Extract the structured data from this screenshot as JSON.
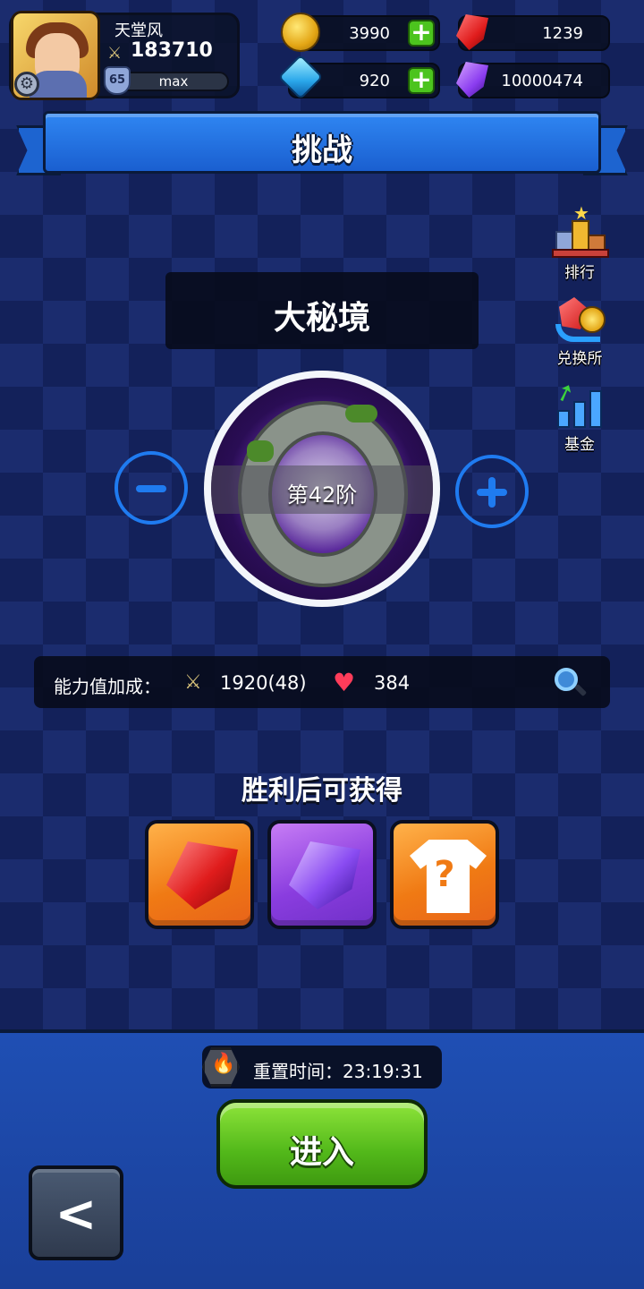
{
  "player": {
    "name": "天堂风",
    "power": "183710",
    "level": "65",
    "level_status": "max"
  },
  "resources": {
    "gold": "3990",
    "diamond": "920",
    "red_gem": "1239",
    "purple_gem": "10000474"
  },
  "header": {
    "title": "挑战"
  },
  "side_menu": {
    "items": [
      {
        "label": "排行",
        "icon": "ranking-podium-icon"
      },
      {
        "label": "兑换所",
        "icon": "exchange-icon"
      },
      {
        "label": "基金",
        "icon": "fund-chart-icon"
      }
    ]
  },
  "dungeon": {
    "name": "大秘境",
    "tier": "第42阶"
  },
  "stats": {
    "label": "能力值加成：",
    "attack": "1920(48)",
    "hp": "384"
  },
  "rewards": {
    "title": "胜利后可获得",
    "items": [
      {
        "icon": "red-gem-icon"
      },
      {
        "icon": "purple-gem-icon"
      },
      {
        "icon": "mystery-outfit-icon"
      }
    ]
  },
  "reset": {
    "label": "重置时间：23:19:31"
  },
  "actions": {
    "enter_label": "进入",
    "back_glyph": "<"
  },
  "colors": {
    "accent_blue": "#1f7bf0",
    "enter_green": "#52b81a",
    "background": "#1b2c6e"
  }
}
